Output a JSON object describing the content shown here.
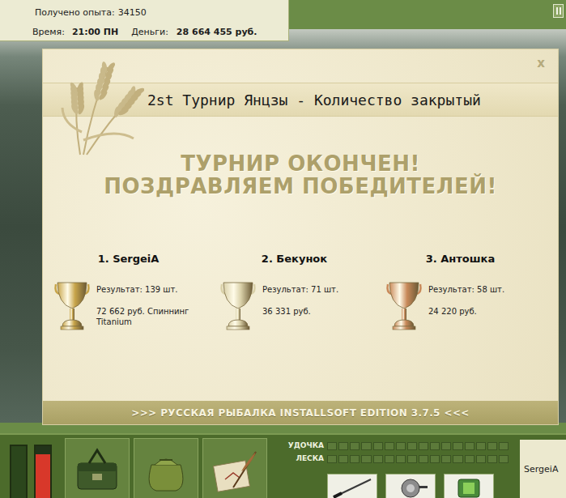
{
  "hud": {
    "experience": {
      "label": "Получено опыта:",
      "value": "34150"
    },
    "time": {
      "label": "Время:",
      "value": "21:00 ПН"
    },
    "money": {
      "label": "Деньги:",
      "value": "28 664 455 руб."
    }
  },
  "dialog": {
    "title": "2st Турнир Янцзы - Количество закрытый",
    "close": "x",
    "headline": [
      "ТУРНИР ОКОНЧЕН!",
      "ПОЗДРАВЛЯЕМ ПОБЕДИТЕЛЕЙ!"
    ],
    "winners": [
      {
        "place": "1. SergeiA",
        "result": "Результат: 139 шт.",
        "prize": "72 662 руб. Спиннинг Titanium",
        "color": "#c8a54a"
      },
      {
        "place": "2. Бекунок",
        "result": "Результат: 71 шт.",
        "prize": "36 331 руб.",
        "color": "#d9d0a8"
      },
      {
        "place": "3. Антошка",
        "result": "Результат: 58 шт.",
        "prize": "24 220 руб.",
        "color": "#c98a5a"
      }
    ],
    "footer": ">>> РУССКАЯ РЫБАЛКА INSTALLSOFT EDITION 3.7.5 <<<"
  },
  "bottom_bar": {
    "meters": [
      {
        "level": 1,
        "color": "#2b461c"
      },
      {
        "level": 0.85,
        "color": "#d8382a"
      }
    ],
    "tackle": [
      {
        "label": "УДОЧКА",
        "level": 0
      },
      {
        "label": "ЛЕСКА",
        "level": 0
      }
    ],
    "player": "SergeiA"
  }
}
